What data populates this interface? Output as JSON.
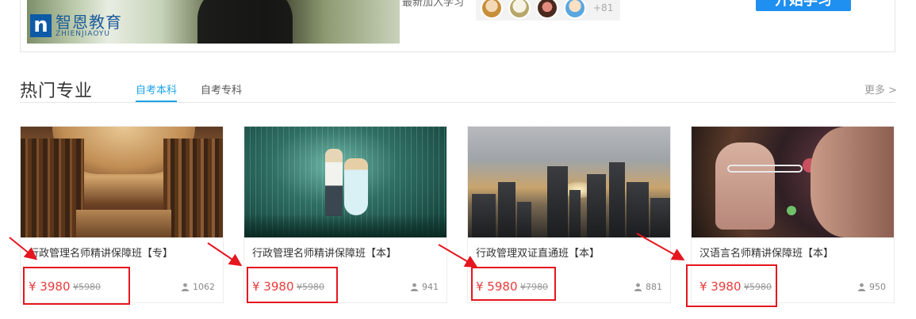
{
  "banner": {
    "logo_mark": "n",
    "logo_cn": "智恩教育",
    "logo_en": "ZHIENJIAOYU",
    "recent_label": "最新加入学习",
    "avatar_count": "+81",
    "start_label": "开始学习"
  },
  "section": {
    "title": "热门专业",
    "tabs": [
      {
        "label": "自考本科",
        "active": true
      },
      {
        "label": "自考专科",
        "active": false
      }
    ],
    "more_label": "更多 >"
  },
  "courses": [
    {
      "title": "行政管理名师精讲保障班【专】",
      "price": "¥ 3980",
      "old_price": "¥5980",
      "students": "1062"
    },
    {
      "title": "行政管理名师精讲保障班【本】",
      "price": "¥ 3980",
      "old_price": "¥5980",
      "students": "941"
    },
    {
      "title": "行政管理双证直通班【本】",
      "price": "¥ 5980",
      "old_price": "¥7980",
      "students": "881"
    },
    {
      "title": "汉语言名师精讲保障班【本】",
      "price": "¥ 3980",
      "old_price": "¥5980",
      "students": "950"
    }
  ],
  "colors": {
    "accent": "#1aa3e8",
    "price": "#e83b3b",
    "highlight": "#e5161f",
    "button": "#1f8ff0"
  },
  "icons": [
    "user-icon",
    "logo-icon"
  ]
}
